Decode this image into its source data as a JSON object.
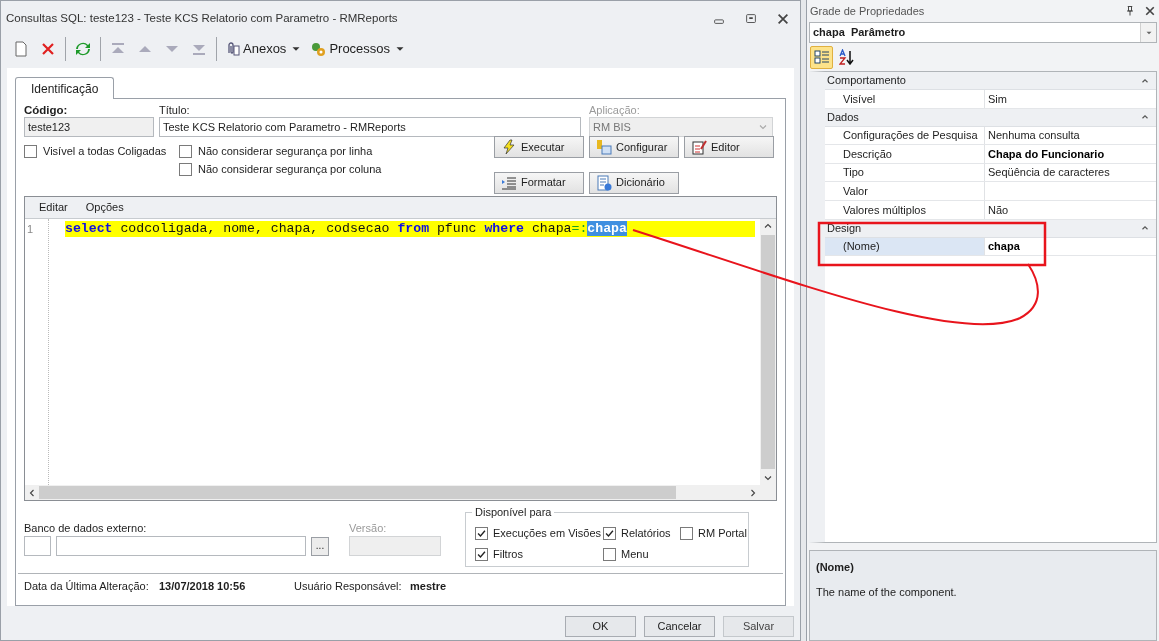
{
  "window": {
    "title": "Consultas SQL: teste123 - Teste KCS Relatorio com Parametro - RMReports"
  },
  "toolbar": [
    {
      "kind": "new"
    },
    {
      "kind": "delete"
    },
    {
      "kind": "refresh"
    },
    {
      "kind": "first"
    },
    {
      "kind": "up"
    },
    {
      "kind": "down"
    },
    {
      "kind": "last"
    },
    {
      "kind": "attach",
      "label": "Anexos"
    },
    {
      "kind": "process",
      "label": "Processos"
    }
  ],
  "tabs": [
    {
      "label": "Identificação",
      "selected": true
    }
  ],
  "form": {
    "codigo": {
      "label": "Código:",
      "value": "teste123"
    },
    "titulo": {
      "label": "Título:",
      "value": "Teste KCS Relatorio com Parametro - RMReports"
    },
    "aplicacao": {
      "label": "Aplicação:",
      "value": "RM BIS",
      "disabled": true
    }
  },
  "options": [
    {
      "label": "Visível a todas Coligadas",
      "checked": false
    },
    {
      "label": "Não considerar segurança por linha",
      "checked": false
    },
    {
      "label": "Não considerar segurança por coluna",
      "checked": false
    }
  ],
  "actions": [
    {
      "kind": "run",
      "label": "Executar"
    },
    {
      "kind": "config",
      "label": "Configurar"
    },
    {
      "kind": "editor",
      "label": "Editor"
    },
    {
      "kind": "format",
      "label": "Formatar"
    },
    {
      "kind": "dictionary",
      "label": "Dicionário"
    }
  ],
  "editor": {
    "menu": [
      "Editar",
      "Opções"
    ],
    "lines": [
      {
        "number": "1",
        "tokens": [
          {
            "kind": "keyword",
            "text": "select"
          },
          {
            "kind": "plain",
            "text": " codcoligada, nome, chapa, codsecao "
          },
          {
            "kind": "keyword",
            "text": "from"
          },
          {
            "kind": "plain",
            "text": " pfunc "
          },
          {
            "kind": "keyword",
            "text": "where"
          },
          {
            "kind": "plain",
            "text": " chapa"
          },
          {
            "kind": "operator",
            "text": "=:"
          },
          {
            "kind": "selected",
            "text": "chapa"
          }
        ]
      }
    ]
  },
  "external_db": {
    "label": "Banco de dados externo:",
    "browse": "...",
    "version_label": "Versão:"
  },
  "available_for": {
    "title": "Disponível para",
    "items": [
      {
        "label": "Execuções em Visões",
        "checked": true
      },
      {
        "label": "Relatórios",
        "checked": true
      },
      {
        "label": "RM Portal",
        "checked": false
      },
      {
        "label": "Filtros",
        "checked": true
      },
      {
        "label": "Menu",
        "checked": false
      }
    ]
  },
  "footer": {
    "date_label": "Data da Última Alteração:",
    "date": "13/07/2018 10:56",
    "user_label": "Usuário Responsável:",
    "user": "mestre"
  },
  "buttons": [
    "OK",
    "Cancelar",
    "Salvar"
  ],
  "properties": {
    "title": "Grade de Propriedades",
    "object": {
      "name": "chapa",
      "type": "Parâmetro"
    },
    "categories": [
      {
        "name": "Comportamento",
        "expanded": true,
        "rows": [
          {
            "name": "Visível",
            "value": "Sim",
            "selected": false
          }
        ]
      },
      {
        "name": "Dados",
        "expanded": true,
        "rows": [
          {
            "name": "Configurações de Pesquisa",
            "value": "Nenhuma consulta",
            "selected": false
          },
          {
            "name": "Descrição",
            "value": "Chapa do Funcionario",
            "modified": true,
            "selected": false
          },
          {
            "name": "Tipo",
            "value": "Seqüência de caracteres",
            "selected": false
          },
          {
            "name": "Valor",
            "selected": false
          },
          {
            "name": "Valores múltiplos",
            "value": "Não",
            "selected": false
          }
        ]
      },
      {
        "name": "Design",
        "expanded": true,
        "rows": [
          {
            "name": "(Nome)",
            "value": "chapa",
            "modified": true,
            "selected": true
          }
        ]
      }
    ],
    "description": {
      "title": "(Nome)",
      "text": "The name of the component."
    }
  }
}
